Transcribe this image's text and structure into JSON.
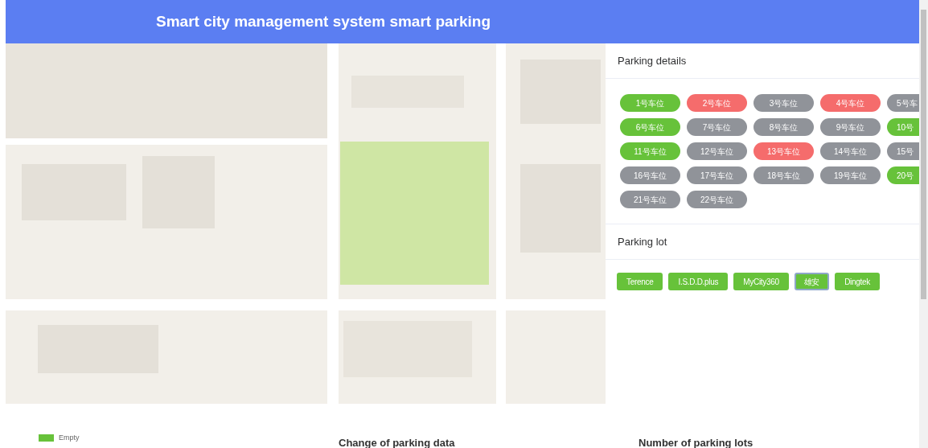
{
  "header": {
    "title": "Smart city management system smart parking"
  },
  "parking_details": {
    "title": "Parking details",
    "spaces": [
      {
        "label": "1号车位",
        "kind": "free"
      },
      {
        "label": "2号车位",
        "kind": "occupied"
      },
      {
        "label": "3号车位",
        "kind": "offline"
      },
      {
        "label": "4号车位",
        "kind": "occupied"
      },
      {
        "label": "5号车",
        "kind": "offline"
      },
      {
        "label": "6号车位",
        "kind": "free"
      },
      {
        "label": "7号车位",
        "kind": "offline"
      },
      {
        "label": "8号车位",
        "kind": "offline"
      },
      {
        "label": "9号车位",
        "kind": "offline"
      },
      {
        "label": "10号",
        "kind": "free"
      },
      {
        "label": "11号车位",
        "kind": "free"
      },
      {
        "label": "12号车位",
        "kind": "offline"
      },
      {
        "label": "13号车位",
        "kind": "occupied"
      },
      {
        "label": "14号车位",
        "kind": "offline"
      },
      {
        "label": "15号",
        "kind": "offline"
      },
      {
        "label": "16号车位",
        "kind": "offline"
      },
      {
        "label": "17号车位",
        "kind": "offline"
      },
      {
        "label": "18号车位",
        "kind": "offline"
      },
      {
        "label": "19号车位",
        "kind": "offline"
      },
      {
        "label": "20号",
        "kind": "free"
      },
      {
        "label": "21号车位",
        "kind": "offline"
      },
      {
        "label": "22号车位",
        "kind": "offline"
      }
    ]
  },
  "parking_lot": {
    "title": "Parking lot",
    "lots": [
      {
        "label": "Terence",
        "selected": false
      },
      {
        "label": "I.S.D.D.plus",
        "selected": false
      },
      {
        "label": "MyCity360",
        "selected": false
      },
      {
        "label": "雄安",
        "selected": true
      },
      {
        "label": "Dingtek",
        "selected": false
      }
    ]
  },
  "legend": [
    {
      "label": "Empty",
      "color": "#67c23a"
    }
  ],
  "chart_titles": [
    "Change of parking data",
    "Number of parking lots"
  ]
}
